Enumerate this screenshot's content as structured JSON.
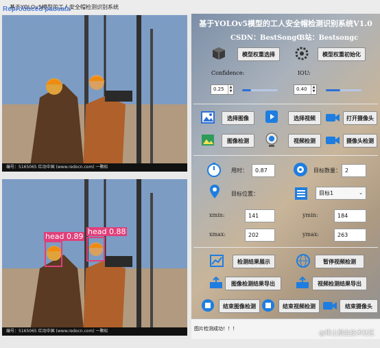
{
  "window": {
    "title": "基于YOLOv5模型的工人安全帽检测识别系统",
    "watermark": "Reproduced pausata"
  },
  "images": {
    "original_caption": "编号：5165065   红动中国 (www.redocn.com)   一颗松",
    "result_caption": "编号：5165065   红动中国 (www.redocn.com)   一颗松",
    "detections": [
      {
        "label": "head 0.89"
      },
      {
        "label": "head 0.88"
      }
    ]
  },
  "panel": {
    "title": "基于YOLOv5模型的工人安全帽检测识别系统V1.0",
    "csdn": "CSDN：BestSongC",
    "bili": "B站：Bestsongc",
    "model_select": "模型权重选择",
    "model_init": "模型权重初始化",
    "confidence_label": "Confidence:",
    "iou_label": "IOU:",
    "confidence_value": "0.25",
    "iou_value": "0.40",
    "confidence_level": 0.25,
    "iou_level": 0.4,
    "select_image": "选择图像",
    "select_video": "选择视频",
    "open_camera": "打开摄像头",
    "image_detect": "图像检测",
    "video_detect": "视频检测",
    "camera_detect": "摄像头检测",
    "time_label": "用时：",
    "time_value": "0.87",
    "count_label": "目标数量：",
    "count_value": "2",
    "position_label": "目标位置：",
    "target_select": "目标1",
    "xmin_label": "xmin:",
    "xmin_value": "141",
    "ymin_label": "ymin:",
    "ymin_value": "184",
    "xmax_label": "xmax:",
    "xmax_value": "202",
    "ymax_label": "ymax:",
    "ymax_value": "263",
    "show_results": "检测结果展示",
    "pause_video": "暂停视频检测",
    "export_image": "图像检测结果导出",
    "export_video": "视频检测结果导出",
    "end_image": "结束图像检测",
    "end_video": "结束视频检测",
    "end_camera": "结束摄像头"
  },
  "status": {
    "text": "图片检测成功！！！"
  },
  "site_watermark": "@稀土掘金技术社区",
  "colors": {
    "bbox": "#e0407a",
    "accent": "#2c6fd6"
  },
  "icons": [
    "cube-icon",
    "settings-icon",
    "image-icon",
    "video-icon",
    "camera-icon",
    "image-detect-icon",
    "webcam-icon",
    "record-icon",
    "timer-icon",
    "target-icon",
    "location-icon",
    "list-icon",
    "chart-icon",
    "globe-icon",
    "export-icon",
    "export-video-icon",
    "stop-icon",
    "stop-video-icon",
    "stop-camera-icon"
  ]
}
